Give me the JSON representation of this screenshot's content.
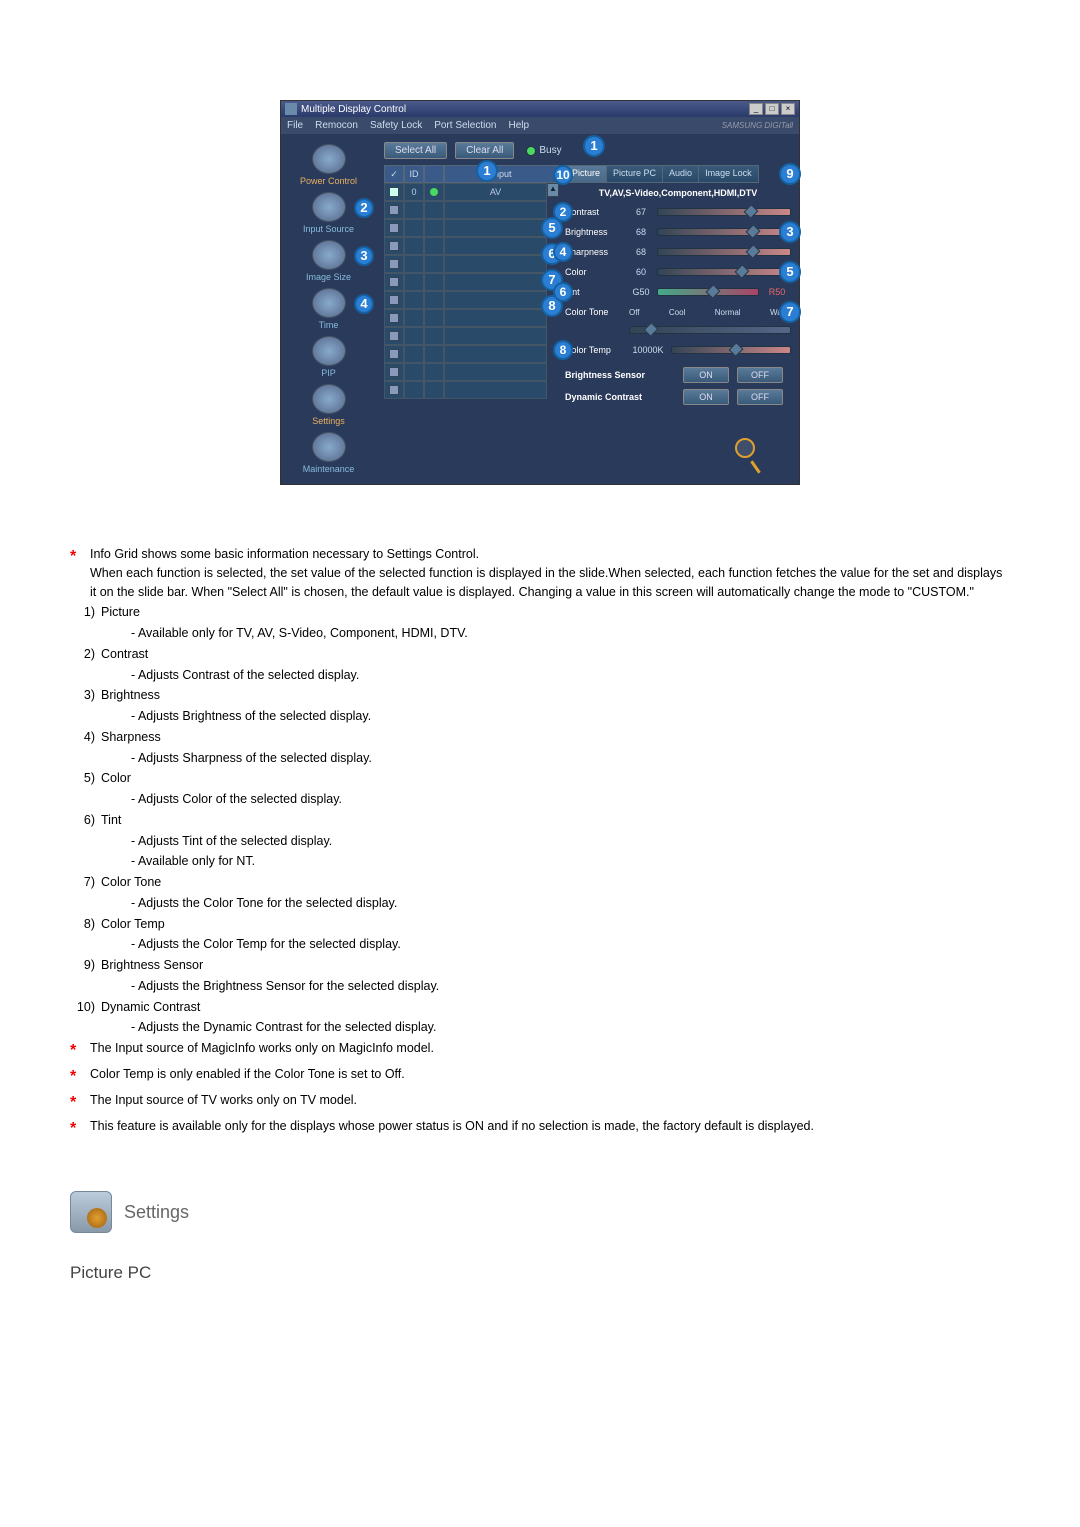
{
  "window": {
    "title": "Multiple Display Control",
    "menu": [
      "File",
      "Remocon",
      "Safety Lock",
      "Port Selection",
      "Help"
    ],
    "brand": "SAMSUNG DIGITall"
  },
  "sidebar": {
    "items": [
      {
        "label": "Power Control"
      },
      {
        "label": "Input Source",
        "callout": "2"
      },
      {
        "label": "Image Size",
        "callout": "3"
      },
      {
        "label": "Time",
        "callout": "4"
      },
      {
        "label": "PIP"
      },
      {
        "label": "Settings"
      },
      {
        "label": "Maintenance"
      }
    ]
  },
  "toolbar": {
    "select_all": "Select All",
    "clear_all": "Clear All",
    "busy": "Busy",
    "callout_under_clear": "1"
  },
  "grid": {
    "headers": {
      "id": "ID",
      "input": "Input"
    },
    "rows": [
      {
        "id": "0",
        "input": "AV",
        "status": "green",
        "checked": true
      },
      {
        "id": "",
        "input": ""
      },
      {
        "id": "",
        "input": ""
      },
      {
        "id": "",
        "input": ""
      },
      {
        "id": "",
        "input": ""
      },
      {
        "id": "",
        "input": ""
      },
      {
        "id": "",
        "input": ""
      },
      {
        "id": "",
        "input": ""
      },
      {
        "id": "",
        "input": ""
      },
      {
        "id": "",
        "input": ""
      },
      {
        "id": "",
        "input": ""
      },
      {
        "id": "",
        "input": ""
      }
    ],
    "input_callouts": [
      "5",
      "6",
      "7",
      "8"
    ]
  },
  "panel": {
    "tabs": [
      "Picture",
      "Picture PC",
      "Audio",
      "Image Lock"
    ],
    "mode_bar": "TV,AV,S-Video,Component,HDMI,DTV",
    "top_callout": "1",
    "sliders": [
      {
        "label": "Contrast",
        "value": "67",
        "left_cal": "2"
      },
      {
        "label": "Brightness",
        "value": "68",
        "right_cal": "3"
      },
      {
        "label": "Sharpness",
        "value": "68",
        "left_cal": "4"
      },
      {
        "label": "Color",
        "value": "60",
        "right_cal": "5"
      },
      {
        "label": "Tint",
        "value": "G50",
        "right_val": "R50",
        "left_cal": "6",
        "tint": true
      }
    ],
    "color_tone": {
      "label": "Color Tone",
      "options": [
        "Off",
        "Cool",
        "Normal",
        "Warm"
      ],
      "right_cal": "7"
    },
    "color_temp": {
      "label": "Color Temp",
      "value": "10000K",
      "left_cal": "8"
    },
    "brightness_sensor": {
      "label": "Brightness Sensor",
      "on": "ON",
      "off": "OFF",
      "right_cal": "9"
    },
    "dynamic_contrast": {
      "label": "Dynamic Contrast",
      "on": "ON",
      "off": "OFF",
      "left_cal": "10"
    }
  },
  "notes": {
    "intro": "Info Grid shows some basic information necessary to Settings Control.",
    "intro2": "When each function is selected, the set value of the selected function is displayed in the slide.When selected, each function fetches the value for the set and displays it on the slide bar. When \"Select All\" is chosen, the default value is displayed. Changing a value in this screen will automatically change the mode to \"CUSTOM.\"",
    "items": [
      {
        "n": "1)",
        "t": "Picture",
        "subs": [
          "- Available only for TV, AV, S-Video, Component, HDMI, DTV."
        ]
      },
      {
        "n": "2)",
        "t": "Contrast",
        "subs": [
          "- Adjusts Contrast of the selected display."
        ]
      },
      {
        "n": "3)",
        "t": "Brightness",
        "subs": [
          "- Adjusts Brightness of the selected display."
        ]
      },
      {
        "n": "4)",
        "t": "Sharpness",
        "subs": [
          "- Adjusts Sharpness of the selected display."
        ]
      },
      {
        "n": "5)",
        "t": "Color",
        "subs": [
          "- Adjusts Color of the selected display."
        ]
      },
      {
        "n": "6)",
        "t": "Tint",
        "subs": [
          "- Adjusts Tint of the selected display.",
          "- Available  only for NT."
        ]
      },
      {
        "n": "7)",
        "t": "Color Tone",
        "subs": [
          "- Adjusts the Color Tone for the selected display."
        ]
      },
      {
        "n": "8)",
        "t": "Color Temp",
        "subs": [
          "- Adjusts the Color Temp for the selected display."
        ]
      },
      {
        "n": "9)",
        "t": "Brightness Sensor",
        "subs": [
          "- Adjusts the Brightness Sensor for the selected display."
        ]
      },
      {
        "n": "10)",
        "t": "Dynamic Contrast",
        "subs": [
          "- Adjusts the Dynamic Contrast for the selected display."
        ]
      }
    ],
    "stars": [
      "The Input source of MagicInfo works only on MagicInfo model.",
      "Color Temp is only enabled if the Color Tone is set to Off.",
      "The Input source of TV works only on TV model.",
      "This feature is available only for the displays whose power status is ON and if no selection is made, the factory default is displayed."
    ]
  },
  "section": {
    "title": "Settings",
    "subtitle": "Picture PC"
  }
}
